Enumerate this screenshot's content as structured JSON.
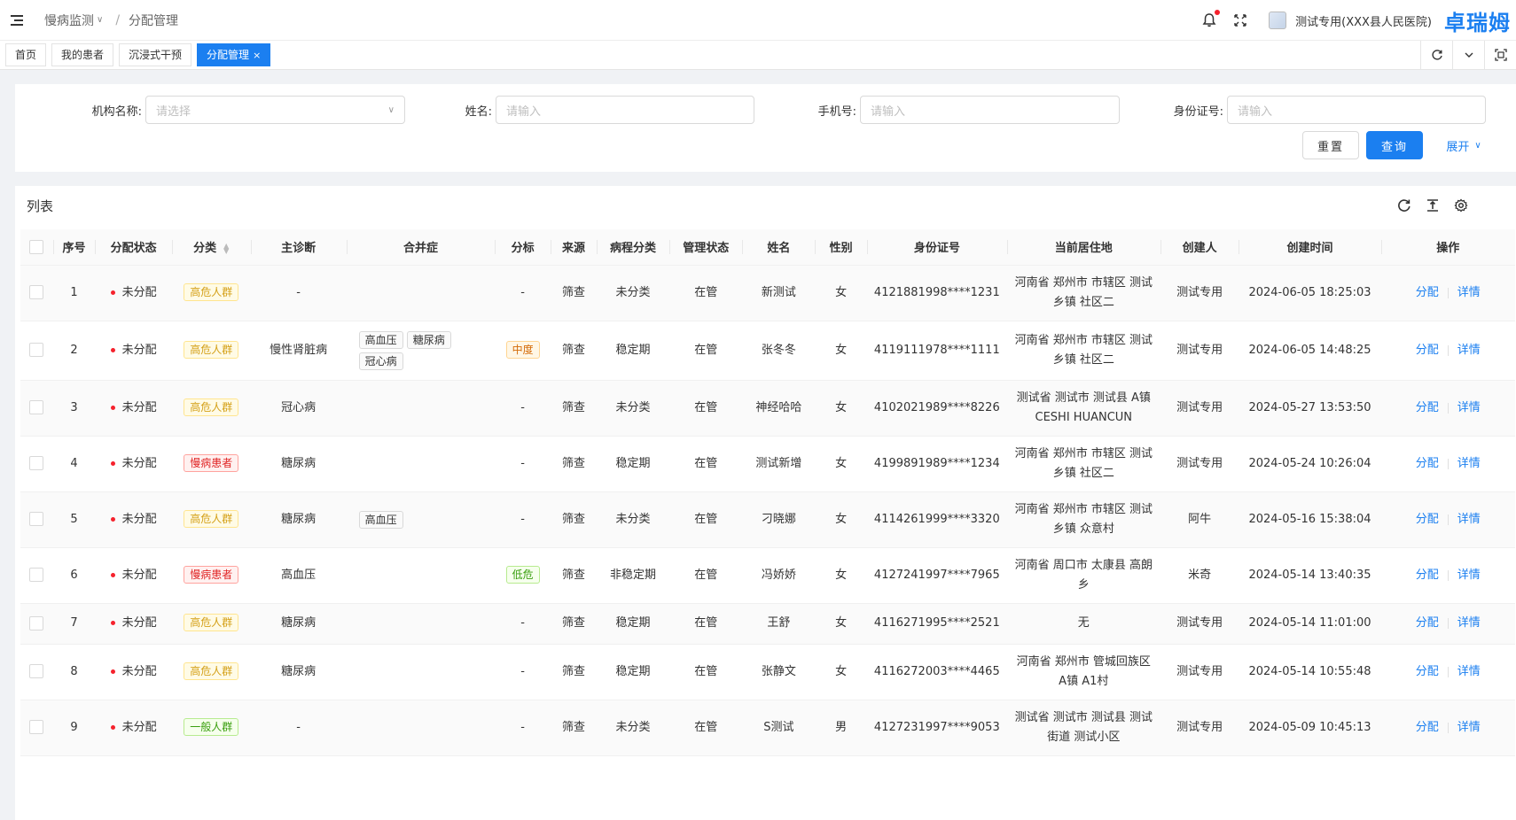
{
  "header": {
    "breadcrumb": [
      "慢病监测",
      "分配管理"
    ],
    "org_name": "测试专用(XXX县人民医院)",
    "brand": "卓瑞姆"
  },
  "tabs": [
    {
      "label": "首页"
    },
    {
      "label": "我的患者"
    },
    {
      "label": "沉浸式干预"
    },
    {
      "label": "分配管理",
      "active": true
    }
  ],
  "search": {
    "org_label": "机构名称:",
    "org_placeholder": "请选择",
    "name_label": "姓名:",
    "name_placeholder": "请输入",
    "phone_label": "手机号:",
    "phone_placeholder": "请输入",
    "id_label": "身份证号:",
    "id_placeholder": "请输入",
    "reset_label": "重置",
    "query_label": "查询",
    "expand_label": "展开"
  },
  "list": {
    "title": "列表",
    "columns": [
      "序号",
      "分配状态",
      "分类",
      "主诊断",
      "合并症",
      "分标",
      "来源",
      "病程分类",
      "管理状态",
      "姓名",
      "性别",
      "身份证号",
      "当前居住地",
      "创建人",
      "创建时间",
      "操作"
    ],
    "action_assign": "分配",
    "action_detail": "详情",
    "rows": [
      {
        "no": "1",
        "status": "未分配",
        "category": "高危人群",
        "category_color": "gold",
        "diagnosis": "-",
        "comorbidities": [],
        "grade": "-",
        "grade_color": "",
        "source": "筛查",
        "course": "未分类",
        "manage": "在管",
        "name": "新测试",
        "gender": "女",
        "id_no": "4121881998****1231",
        "address": "河南省 郑州市 市辖区 测试乡镇 社区二",
        "creator": "测试专用",
        "created": "2024-06-05 18:25:03"
      },
      {
        "no": "2",
        "status": "未分配",
        "category": "高危人群",
        "category_color": "gold",
        "diagnosis": "慢性肾脏病",
        "comorbidities": [
          "高血压",
          "糖尿病",
          "冠心病"
        ],
        "grade": "中度",
        "grade_color": "orange",
        "source": "筛查",
        "course": "稳定期",
        "manage": "在管",
        "name": "张冬冬",
        "gender": "女",
        "id_no": "4119111978****1111",
        "address": "河南省 郑州市 市辖区 测试乡镇 社区二",
        "creator": "测试专用",
        "created": "2024-06-05 14:48:25"
      },
      {
        "no": "3",
        "status": "未分配",
        "category": "高危人群",
        "category_color": "gold",
        "diagnosis": "冠心病",
        "comorbidities": [],
        "grade": "-",
        "grade_color": "",
        "source": "筛查",
        "course": "未分类",
        "manage": "在管",
        "name": "神经哈哈",
        "gender": "女",
        "id_no": "4102021989****8226",
        "address": "测试省 测试市 测试县 A镇 CESHI HUANCUN",
        "creator": "测试专用",
        "created": "2024-05-27 13:53:50"
      },
      {
        "no": "4",
        "status": "未分配",
        "category": "慢病患者",
        "category_color": "red",
        "diagnosis": "糖尿病",
        "comorbidities": [],
        "grade": "-",
        "grade_color": "",
        "source": "筛查",
        "course": "稳定期",
        "manage": "在管",
        "name": "测试新增",
        "gender": "女",
        "id_no": "4199891989****1234",
        "address": "河南省 郑州市 市辖区 测试乡镇 社区二",
        "creator": "测试专用",
        "created": "2024-05-24 10:26:04"
      },
      {
        "no": "5",
        "status": "未分配",
        "category": "高危人群",
        "category_color": "gold",
        "diagnosis": "糖尿病",
        "comorbidities": [
          "高血压"
        ],
        "grade": "-",
        "grade_color": "",
        "source": "筛查",
        "course": "未分类",
        "manage": "在管",
        "name": "刁晓娜",
        "gender": "女",
        "id_no": "4114261999****3320",
        "address": "河南省 郑州市 市辖区 测试乡镇 众意村",
        "creator": "阿牛",
        "created": "2024-05-16 15:38:04"
      },
      {
        "no": "6",
        "status": "未分配",
        "category": "慢病患者",
        "category_color": "red",
        "diagnosis": "高血压",
        "comorbidities": [],
        "grade": "低危",
        "grade_color": "green",
        "source": "筛查",
        "course": "非稳定期",
        "manage": "在管",
        "name": "冯娇娇",
        "gender": "女",
        "id_no": "4127241997****7965",
        "address": "河南省 周口市 太康县 高朗乡",
        "creator": "米奇",
        "created": "2024-05-14 13:40:35"
      },
      {
        "no": "7",
        "status": "未分配",
        "category": "高危人群",
        "category_color": "gold",
        "diagnosis": "糖尿病",
        "comorbidities": [],
        "grade": "-",
        "grade_color": "",
        "source": "筛查",
        "course": "稳定期",
        "manage": "在管",
        "name": "王舒",
        "gender": "女",
        "id_no": "4116271995****2521",
        "address": "无",
        "creator": "测试专用",
        "created": "2024-05-14 11:01:00"
      },
      {
        "no": "8",
        "status": "未分配",
        "category": "高危人群",
        "category_color": "gold",
        "diagnosis": "糖尿病",
        "comorbidities": [],
        "grade": "-",
        "grade_color": "",
        "source": "筛查",
        "course": "稳定期",
        "manage": "在管",
        "name": "张静文",
        "gender": "女",
        "id_no": "4116272003****4465",
        "address": "河南省 郑州市 管城回族区 A镇 A1村",
        "creator": "测试专用",
        "created": "2024-05-14 10:55:48"
      },
      {
        "no": "9",
        "status": "未分配",
        "category": "一般人群",
        "category_color": "green",
        "diagnosis": "-",
        "comorbidities": [],
        "grade": "-",
        "grade_color": "",
        "source": "筛查",
        "course": "未分类",
        "manage": "在管",
        "name": "S测试",
        "gender": "男",
        "id_no": "4127231997****9053",
        "address": "测试省 测试市 测试县 测试街道 测试小区",
        "creator": "测试专用",
        "created": "2024-05-09 10:45:13"
      }
    ]
  }
}
